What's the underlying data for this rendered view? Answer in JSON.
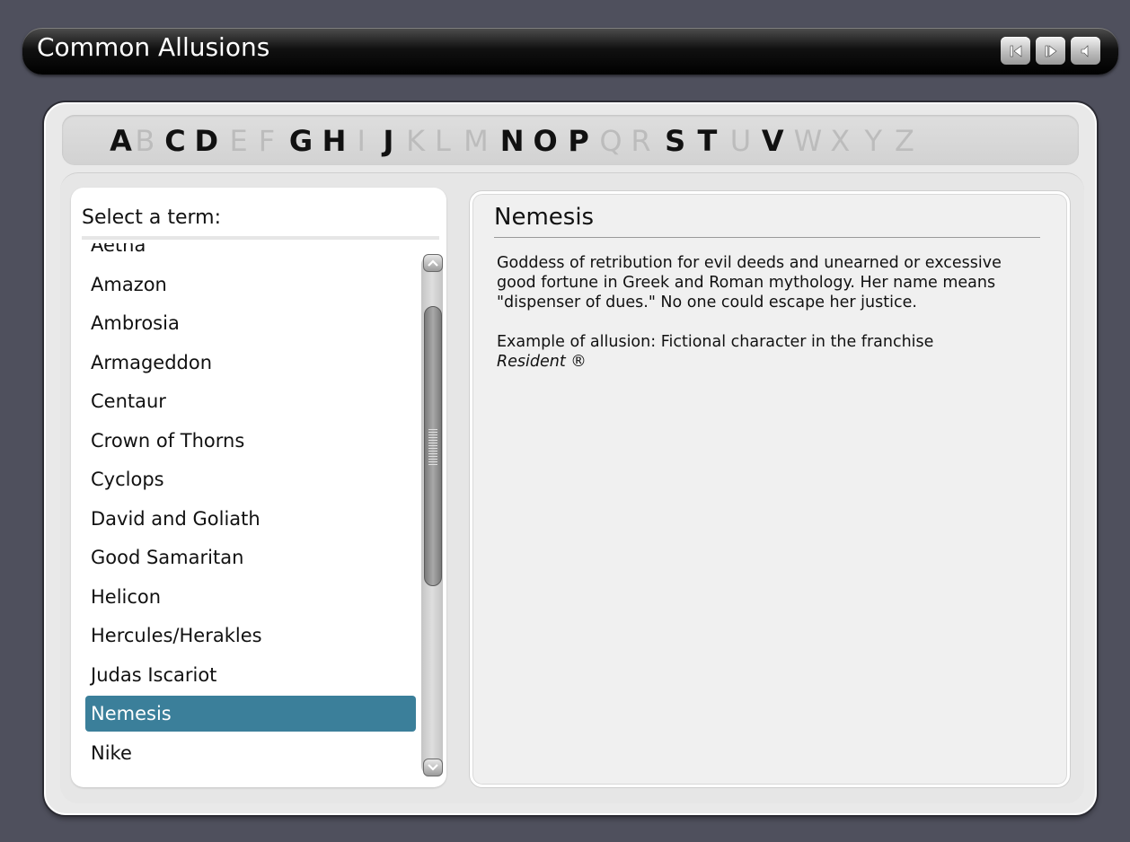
{
  "app": {
    "title": "Common Allusions",
    "nav_buttons": [
      {
        "name": "previous-button",
        "icon": "step-back-icon"
      },
      {
        "name": "next-button",
        "icon": "step-forward-icon"
      },
      {
        "name": "audio-button",
        "icon": "speaker-icon"
      }
    ]
  },
  "alphabet": [
    {
      "letter": "A",
      "enabled": true
    },
    {
      "letter": "B",
      "enabled": false
    },
    {
      "letter": "C",
      "enabled": true
    },
    {
      "letter": "D",
      "enabled": true
    },
    {
      "letter": "E",
      "enabled": false
    },
    {
      "letter": "F",
      "enabled": false
    },
    {
      "letter": "G",
      "enabled": true
    },
    {
      "letter": "H",
      "enabled": true
    },
    {
      "letter": "I",
      "enabled": false
    },
    {
      "letter": "J",
      "enabled": true
    },
    {
      "letter": "K",
      "enabled": false
    },
    {
      "letter": "L",
      "enabled": false
    },
    {
      "letter": "M",
      "enabled": false
    },
    {
      "letter": "N",
      "enabled": true
    },
    {
      "letter": "O",
      "enabled": true
    },
    {
      "letter": "P",
      "enabled": true
    },
    {
      "letter": "Q",
      "enabled": false
    },
    {
      "letter": "R",
      "enabled": false
    },
    {
      "letter": "S",
      "enabled": true
    },
    {
      "letter": "T",
      "enabled": true
    },
    {
      "letter": "U",
      "enabled": false
    },
    {
      "letter": "V",
      "enabled": true
    },
    {
      "letter": "W",
      "enabled": false
    },
    {
      "letter": "X",
      "enabled": false
    },
    {
      "letter": "Y",
      "enabled": false
    },
    {
      "letter": "Z",
      "enabled": false
    }
  ],
  "term_list": {
    "header": "Select a term:",
    "items": [
      "Aetna",
      "Amazon",
      "Ambrosia",
      "Armageddon",
      "Centaur",
      "Crown of Thorns",
      "Cyclops",
      "David and Goliath",
      "Good Samaritan",
      "Helicon",
      "Hercules/Herakles",
      "Judas Iscariot",
      "Nemesis",
      "Nike"
    ],
    "selected": "Nemesis"
  },
  "definition": {
    "term": "Nemesis",
    "text": "Goddess of retribution for evil deeds and unearned or excessive good fortune in Greek and Roman mythology. Her name means \"dispenser of dues.\" No one could escape her justice.",
    "example_prefix": "Example of allusion: Fictional character in the franchise",
    "example_work": "Resident ®"
  },
  "colors": {
    "background": "#4f505d",
    "selected_item": "#3b7f9a",
    "disabled_letter": "#bcbcbc"
  }
}
